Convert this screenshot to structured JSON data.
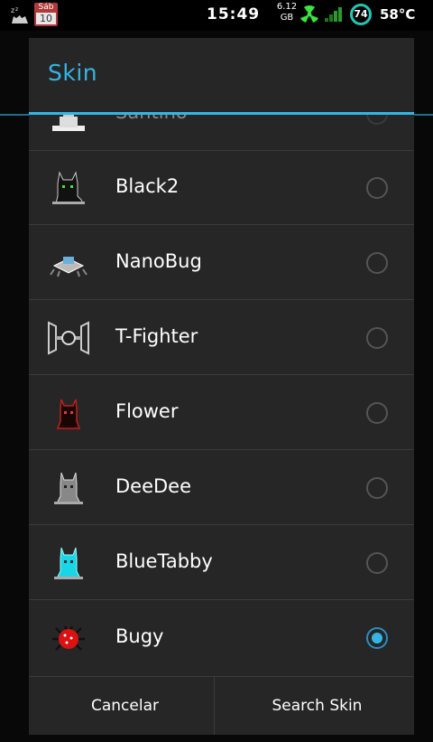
{
  "status_bar": {
    "time": "15:49",
    "calendar": {
      "weekday": "Sáb",
      "day": "10"
    },
    "storage": {
      "value": "6.12",
      "unit": "GB"
    },
    "battery": "74",
    "temperature": "58°C"
  },
  "dialog": {
    "title": "Skin",
    "partial_item_label": "Santino",
    "items": [
      {
        "label": "Black2",
        "selected": false,
        "icon": "black-cat-icon"
      },
      {
        "label": "NanoBug",
        "selected": false,
        "icon": "nanobug-icon"
      },
      {
        "label": "T-Fighter",
        "selected": false,
        "icon": "tie-fighter-icon"
      },
      {
        "label": "Flower",
        "selected": false,
        "icon": "red-cat-icon"
      },
      {
        "label": "DeeDee",
        "selected": false,
        "icon": "gray-cat-icon"
      },
      {
        "label": "BlueTabby",
        "selected": false,
        "icon": "blue-cat-icon"
      },
      {
        "label": "Bugy",
        "selected": true,
        "icon": "red-bug-icon"
      }
    ],
    "buttons": {
      "cancel": "Cancelar",
      "search": "Search Skin"
    }
  },
  "colors": {
    "accent": "#35b5e5",
    "dialog_bg": "#262626"
  }
}
